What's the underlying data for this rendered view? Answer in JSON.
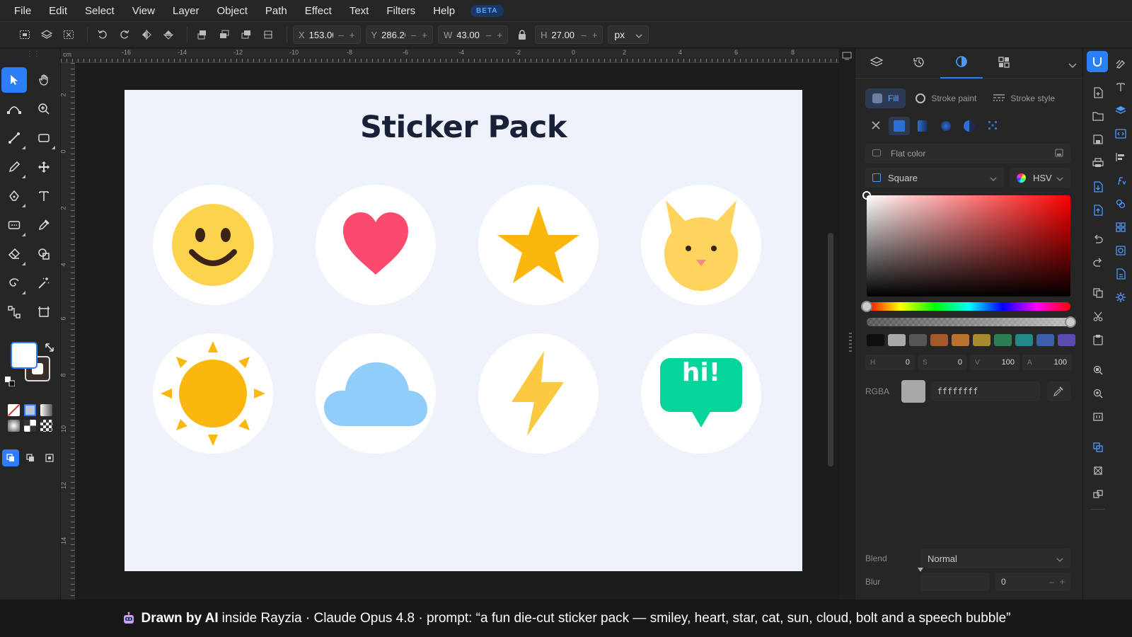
{
  "menu": {
    "items": [
      "File",
      "Edit",
      "Select",
      "View",
      "Layer",
      "Object",
      "Path",
      "Effect",
      "Text",
      "Filters",
      "Help"
    ],
    "beta_label": "BETA"
  },
  "toolbar": {
    "x_label": "X",
    "x_value": "153.00",
    "y_label": "Y",
    "y_value": "286.20",
    "w_label": "W",
    "w_value": "43.00",
    "h_label": "H",
    "h_value": "27.00",
    "minus": "–",
    "plus": "+",
    "unit": "px"
  },
  "rulers": {
    "top": [
      "-16",
      "-14",
      "-12",
      "-10",
      "-8",
      "-6",
      "-4",
      "-2",
      "0",
      "2",
      "4",
      "6",
      "8"
    ],
    "left": [
      "2",
      "0",
      "2",
      "4",
      "6",
      "8",
      "10",
      "12",
      "14"
    ],
    "corner": "cm"
  },
  "artboard": {
    "title": "Sticker Pack",
    "stickers": [
      "smiley",
      "heart",
      "star",
      "cat",
      "sun",
      "cloud",
      "bolt",
      "speech-bubble"
    ],
    "bubble_text": "hi!"
  },
  "right_panel": {
    "tabs": [
      "layers-icon",
      "history-icon",
      "fill-stroke-icon",
      "components-icon"
    ],
    "subtabs": {
      "fill": "Fill",
      "stroke_paint": "Stroke paint",
      "stroke_style": "Stroke style"
    },
    "flat_color_label": "Flat color",
    "shape_select": "Square",
    "mode_select": "HSV",
    "swatch_colors": [
      "#0f0f0f",
      "#a9a9a9",
      "#555555",
      "#a35a2a",
      "#b8722e",
      "#a58a2e",
      "#2f7d52",
      "#238787",
      "#3c5fa8",
      "#5b4ab0"
    ],
    "hsva": [
      {
        "label": "H",
        "value": "0"
      },
      {
        "label": "S",
        "value": "0"
      },
      {
        "label": "V",
        "value": "100"
      },
      {
        "label": "A",
        "value": "100"
      }
    ],
    "rgba_label": "RGBA",
    "rgba_value": "ffffffff",
    "blend_label": "Blend",
    "blend_value": "Normal",
    "blur_label": "Blur",
    "blur_value": "0"
  },
  "banner": {
    "bold": "Drawn by AI",
    "rest": "inside Rayzia · Claude Opus 4.8 · prompt: “a fun die-cut sticker pack — smiley, heart, star, cat, sun, cloud, bolt and a speech bubble”"
  },
  "colors": {
    "accent": "#2d7ff9",
    "artboard_bg": "#eef2fb",
    "title": "#182138",
    "smiley": "#fcd34d",
    "heart": "#fb4a6d",
    "star": "#fbb70e",
    "cat": "#fed35e",
    "sun": "#fbb70e",
    "cloud": "#90cdf9",
    "bolt": "#fbca42",
    "bubble": "#05d49b"
  }
}
